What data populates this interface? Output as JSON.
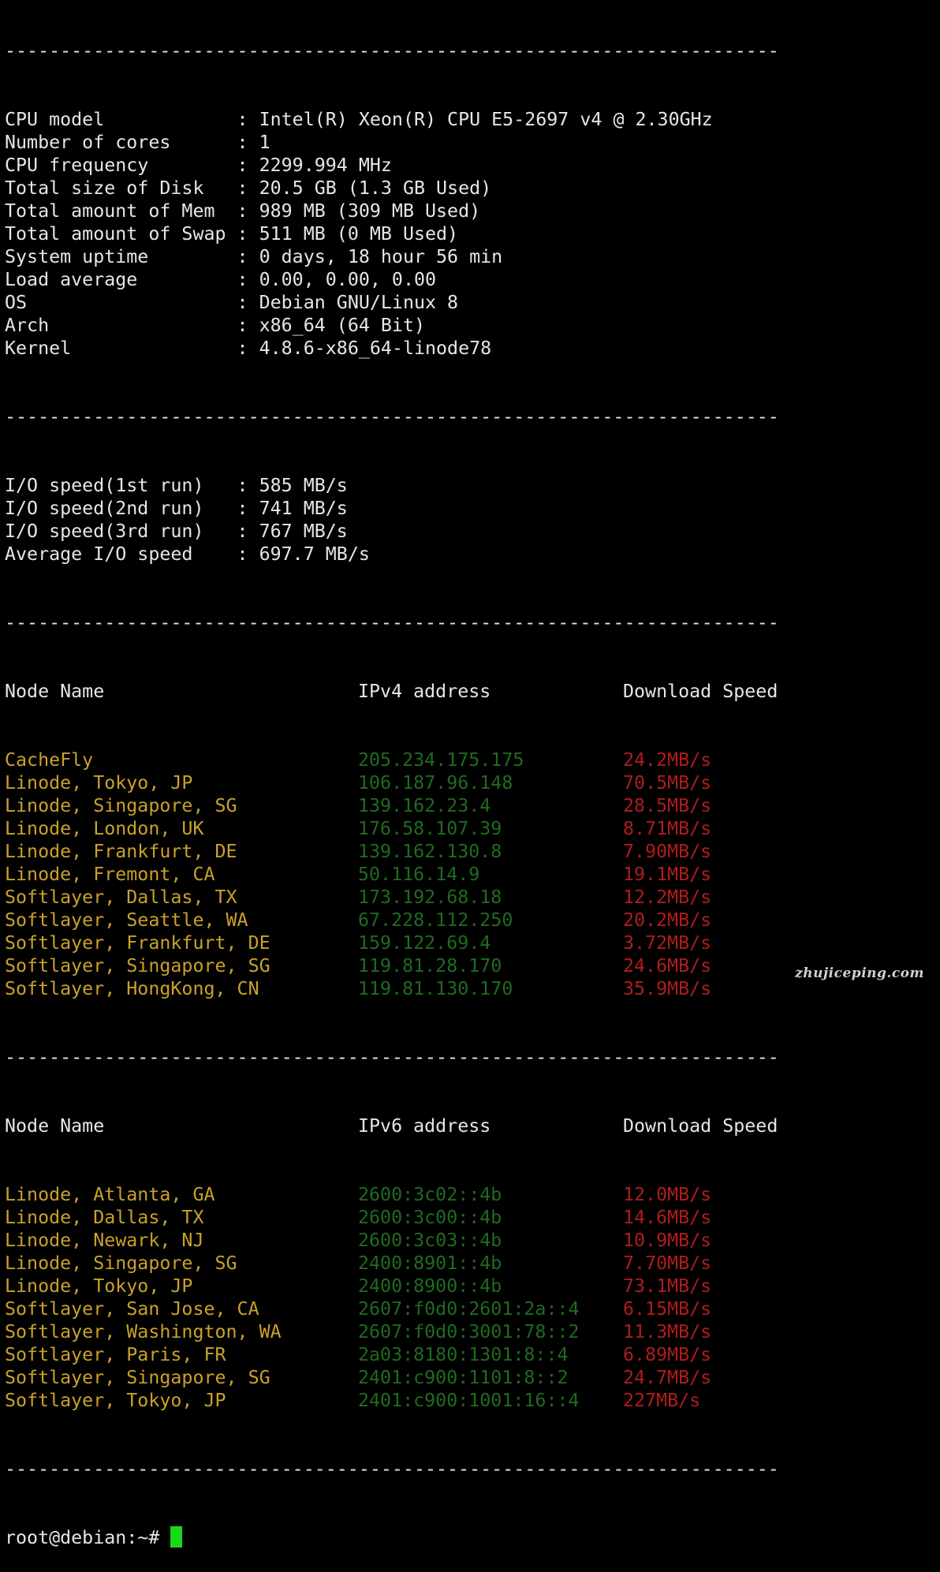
{
  "separator": "----------------------------------------------------------------------",
  "system_info": [
    {
      "label": "CPU model           ",
      "value": "Intel(R) Xeon(R) CPU E5-2697 v4 @ 2.30GHz"
    },
    {
      "label": "Number of cores     ",
      "value": "1"
    },
    {
      "label": "CPU frequency       ",
      "value": "2299.994 MHz"
    },
    {
      "label": "Total size of Disk  ",
      "value": "20.5 GB (1.3 GB Used)"
    },
    {
      "label": "Total amount of Mem ",
      "value": "989 MB (309 MB Used)"
    },
    {
      "label": "Total amount of Swap",
      "value": "511 MB (0 MB Used)"
    },
    {
      "label": "System uptime       ",
      "value": "0 days, 18 hour 56 min"
    },
    {
      "label": "Load average        ",
      "value": "0.00, 0.00, 0.00"
    },
    {
      "label": "OS                  ",
      "value": "Debian GNU/Linux 8"
    },
    {
      "label": "Arch                ",
      "value": "x86_64 (64 Bit)"
    },
    {
      "label": "Kernel              ",
      "value": "4.8.6-x86_64-linode78"
    }
  ],
  "io_info": [
    {
      "label": "I/O speed(1st run)  ",
      "value": "585 MB/s"
    },
    {
      "label": "I/O speed(2nd run)  ",
      "value": "741 MB/s"
    },
    {
      "label": "I/O speed(3rd run)  ",
      "value": "767 MB/s"
    },
    {
      "label": "Average I/O speed   ",
      "value": "697.7 MB/s"
    }
  ],
  "ipv4_table": {
    "headers": {
      "name": "Node Name",
      "ip": "IPv4 address",
      "speed": "Download Speed"
    },
    "rows": [
      {
        "name": "CacheFly",
        "ip": "205.234.175.175",
        "speed": "24.2MB/s"
      },
      {
        "name": "Linode, Tokyo, JP",
        "ip": "106.187.96.148",
        "speed": "70.5MB/s"
      },
      {
        "name": "Linode, Singapore, SG",
        "ip": "139.162.23.4",
        "speed": "28.5MB/s"
      },
      {
        "name": "Linode, London, UK",
        "ip": "176.58.107.39",
        "speed": "8.71MB/s"
      },
      {
        "name": "Linode, Frankfurt, DE",
        "ip": "139.162.130.8",
        "speed": "7.90MB/s"
      },
      {
        "name": "Linode, Fremont, CA",
        "ip": "50.116.14.9",
        "speed": "19.1MB/s"
      },
      {
        "name": "Softlayer, Dallas, TX",
        "ip": "173.192.68.18",
        "speed": "12.2MB/s"
      },
      {
        "name": "Softlayer, Seattle, WA",
        "ip": "67.228.112.250",
        "speed": "20.2MB/s"
      },
      {
        "name": "Softlayer, Frankfurt, DE",
        "ip": "159.122.69.4",
        "speed": "3.72MB/s"
      },
      {
        "name": "Softlayer, Singapore, SG",
        "ip": "119.81.28.170",
        "speed": "24.6MB/s"
      },
      {
        "name": "Softlayer, HongKong, CN",
        "ip": "119.81.130.170",
        "speed": "35.9MB/s"
      }
    ]
  },
  "ipv6_table": {
    "headers": {
      "name": "Node Name",
      "ip": "IPv6 address",
      "speed": "Download Speed"
    },
    "rows": [
      {
        "name": "Linode, Atlanta, GA",
        "ip": "2600:3c02::4b",
        "speed": "12.0MB/s"
      },
      {
        "name": "Linode, Dallas, TX",
        "ip": "2600:3c00::4b",
        "speed": "14.6MB/s"
      },
      {
        "name": "Linode, Newark, NJ",
        "ip": "2600:3c03::4b",
        "speed": "10.9MB/s"
      },
      {
        "name": "Linode, Singapore, SG",
        "ip": "2400:8901::4b",
        "speed": "7.70MB/s"
      },
      {
        "name": "Linode, Tokyo, JP",
        "ip": "2400:8900::4b",
        "speed": "73.1MB/s"
      },
      {
        "name": "Softlayer, San Jose, CA",
        "ip": "2607:f0d0:2601:2a::4",
        "speed": "6.15MB/s"
      },
      {
        "name": "Softlayer, Washington, WA",
        "ip": "2607:f0d0:3001:78::2",
        "speed": "11.3MB/s"
      },
      {
        "name": "Softlayer, Paris, FR",
        "ip": "2a03:8180:1301:8::4",
        "speed": "6.89MB/s"
      },
      {
        "name": "Softlayer, Singapore, SG",
        "ip": "2401:c900:1101:8::2",
        "speed": "24.7MB/s"
      },
      {
        "name": "Softlayer, Tokyo, JP",
        "ip": "2401:c900:1001:16::4",
        "speed": "227MB/s"
      }
    ]
  },
  "prompt": "root@debian:~# ",
  "watermark": "zhujiceping.com",
  "colors": {
    "background": "#000000",
    "text": "#e6e6e6",
    "node_name": "#c9a227",
    "ip_address": "#1f6b1f",
    "download_speed": "#b01c1c",
    "cursor": "#18d818"
  }
}
